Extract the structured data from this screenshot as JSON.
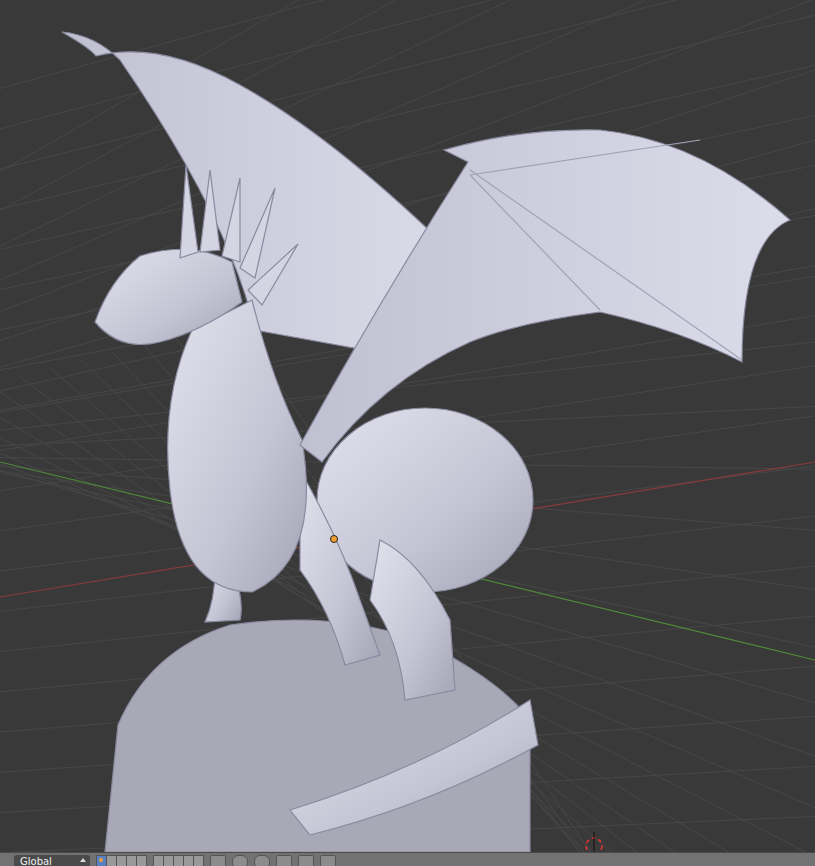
{
  "viewport": {
    "name": "3D View",
    "object": {
      "name": "Dragon sculpture"
    }
  },
  "header": {
    "orientation": {
      "label": "Global"
    },
    "layers": [
      {
        "selected": true,
        "used": true
      },
      {
        "selected": false,
        "used": false
      },
      {
        "selected": false,
        "used": false
      },
      {
        "selected": false,
        "used": false
      },
      {
        "selected": false,
        "used": false
      },
      {
        "selected": false,
        "used": false
      },
      {
        "selected": false,
        "used": false
      },
      {
        "selected": false,
        "used": false
      },
      {
        "selected": false,
        "used": false
      },
      {
        "selected": false,
        "used": false
      }
    ]
  }
}
